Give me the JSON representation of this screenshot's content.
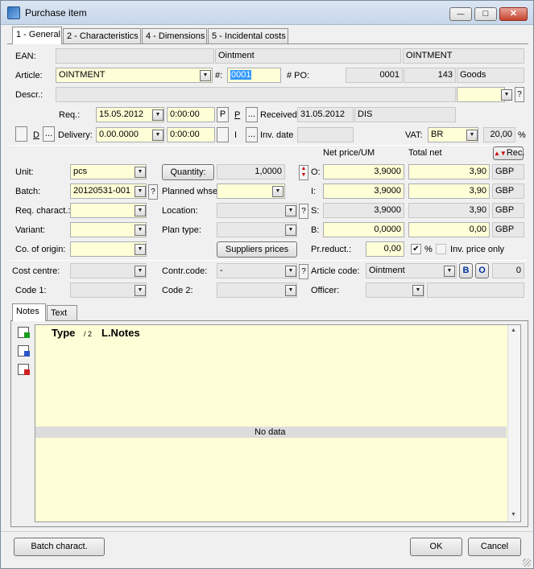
{
  "window": {
    "title": "Purchase item"
  },
  "tabs": [
    "1 - General",
    "2 - Characteristics",
    "4 - Dimensions",
    "5 - Incidental costs"
  ],
  "header": {
    "ean_label": "EAN:",
    "ean_value": "",
    "ean_name": "Ointment",
    "ean_code": "OINTMENT",
    "article_label": "Article:",
    "article_value": "OINTMENT",
    "hash_label": "#:",
    "hash_value": "0001",
    "po_label": "# PO:",
    "po_value": "0001",
    "po_num": "143",
    "po_type": "Goods",
    "descr_label": "Descr.:",
    "descr_value": "",
    "descr_extra": ""
  },
  "dates": {
    "req_label": "Req.:",
    "req_date": "15.05.2012",
    "req_time": "0:00:00",
    "p_button": "P",
    "p_link": "P",
    "received_label": "Received:",
    "received_date": "31.05.2012",
    "received_code": "DIS",
    "d_link": "D",
    "delivery_label": "Delivery:",
    "delivery_date": "0.00.0000",
    "delivery_time": "0:00:00",
    "i_label": "I",
    "inv_date_label": "Inv. date",
    "inv_date_value": "",
    "vat_label": "VAT:",
    "vat_value": "BR",
    "vat_rate": "20,00",
    "vat_unit": "%",
    "ellipsis": "..."
  },
  "pricing": {
    "net_price_header": "Net price/UM",
    "total_net_header": "Total net",
    "rec_button": "Rec.",
    "unit_label": "Unit:",
    "unit_value": "pcs",
    "quantity_button": "Quantity:",
    "quantity_value": "1,0000",
    "batch_label": "Batch:",
    "batch_value": "20120531-001",
    "planned_whse_label": "Planned whse",
    "planned_whse_value": "",
    "req_charact_label": "Req. charact.:",
    "req_charact_value": "",
    "location_label": "Location:",
    "location_value": "",
    "variant_label": "Variant:",
    "variant_value": "",
    "plan_type_label": "Plan type:",
    "plan_type_value": "",
    "origin_label": "Co. of origin:",
    "origin_value": "",
    "suppliers_button": "Suppliers prices",
    "o_label": "O:",
    "o_price": "3,9000",
    "o_total": "3,90",
    "o_cur": "GBP",
    "i_label": "I:",
    "i_price": "3,9000",
    "i_total": "3,90",
    "i_cur": "GBP",
    "s_label": "S:",
    "s_price": "3,9000",
    "s_total": "3,90",
    "s_cur": "GBP",
    "b_label": "B:",
    "b_price": "0,0000",
    "b_total": "0,00",
    "b_cur": "GBP",
    "preduct_label": "Pr.reduct.:",
    "preduct_value": "0,00",
    "preduct_unit": "%",
    "inv_price_only_label": "Inv. price only"
  },
  "costs": {
    "cost_centre_label": "Cost centre:",
    "cost_centre_value": "",
    "contr_code_label": "Contr.code:",
    "contr_code_value": "-",
    "article_code_label": "Article code:",
    "article_code_value": "Ointment",
    "b_btn": "B",
    "o_btn": "O",
    "article_code_num": "0",
    "code1_label": "Code 1:",
    "code1_value": "",
    "code2_label": "Code 2:",
    "code2_value": "",
    "officer_label": "Officer:",
    "officer_value": "",
    "officer_extra": ""
  },
  "notes": {
    "tabs": [
      "Notes",
      "Text"
    ],
    "col_type": "Type",
    "col_sort": "/ 2",
    "col_notes": "L.Notes",
    "no_data": "No data"
  },
  "footer": {
    "batch_charact": "Batch charact.",
    "ok": "OK",
    "cancel": "Cancel"
  },
  "icons": {
    "help": "?",
    "dropdown": "▼",
    "minimize": "—",
    "maximize": "□",
    "close": "✕"
  }
}
